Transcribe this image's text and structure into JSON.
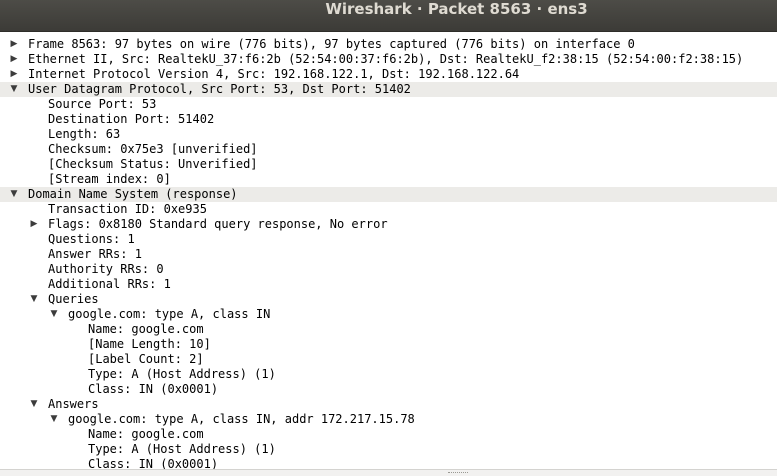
{
  "window": {
    "title": "Wireshark · Packet 8563 · ens3"
  },
  "tree": [
    {
      "level": 0,
      "arrow": "right",
      "text": "Frame 8563: 97 bytes on wire (776 bits), 97 bytes captured (776 bits) on interface 0"
    },
    {
      "level": 0,
      "arrow": "right",
      "text": "Ethernet II, Src: RealtekU_37:f6:2b (52:54:00:37:f6:2b), Dst: RealtekU_f2:38:15 (52:54:00:f2:38:15)"
    },
    {
      "level": 0,
      "arrow": "right",
      "text": "Internet Protocol Version 4, Src: 192.168.122.1, Dst: 192.168.122.64"
    },
    {
      "level": 0,
      "arrow": "down",
      "text": "User Datagram Protocol, Src Port: 53, Dst Port: 51402",
      "shaded": true
    },
    {
      "level": 1,
      "arrow": "",
      "text": "Source Port: 53"
    },
    {
      "level": 1,
      "arrow": "",
      "text": "Destination Port: 51402"
    },
    {
      "level": 1,
      "arrow": "",
      "text": "Length: 63"
    },
    {
      "level": 1,
      "arrow": "",
      "text": "Checksum: 0x75e3 [unverified]"
    },
    {
      "level": 1,
      "arrow": "",
      "text": "[Checksum Status: Unverified]"
    },
    {
      "level": 1,
      "arrow": "",
      "text": "[Stream index: 0]"
    },
    {
      "level": 0,
      "arrow": "down",
      "text": "Domain Name System (response)",
      "shaded": true
    },
    {
      "level": 1,
      "arrow": "",
      "text": "Transaction ID: 0xe935"
    },
    {
      "level": 1,
      "arrow": "right",
      "text": "Flags: 0x8180 Standard query response, No error"
    },
    {
      "level": 1,
      "arrow": "",
      "text": "Questions: 1"
    },
    {
      "level": 1,
      "arrow": "",
      "text": "Answer RRs: 1"
    },
    {
      "level": 1,
      "arrow": "",
      "text": "Authority RRs: 0"
    },
    {
      "level": 1,
      "arrow": "",
      "text": "Additional RRs: 1"
    },
    {
      "level": 1,
      "arrow": "down",
      "text": "Queries"
    },
    {
      "level": 2,
      "arrow": "down",
      "text": "google.com: type A, class IN"
    },
    {
      "level": 3,
      "arrow": "",
      "text": "Name: google.com"
    },
    {
      "level": 3,
      "arrow": "",
      "text": "[Name Length: 10]"
    },
    {
      "level": 3,
      "arrow": "",
      "text": "[Label Count: 2]"
    },
    {
      "level": 3,
      "arrow": "",
      "text": "Type: A (Host Address) (1)"
    },
    {
      "level": 3,
      "arrow": "",
      "text": "Class: IN (0x0001)"
    },
    {
      "level": 1,
      "arrow": "down",
      "text": "Answers"
    },
    {
      "level": 2,
      "arrow": "down",
      "text": "google.com: type A, class IN, addr 172.217.15.78"
    },
    {
      "level": 3,
      "arrow": "",
      "text": "Name: google.com"
    },
    {
      "level": 3,
      "arrow": "",
      "text": "Type: A (Host Address) (1)"
    },
    {
      "level": 3,
      "arrow": "",
      "text": "Class: IN (0x0001)"
    }
  ]
}
